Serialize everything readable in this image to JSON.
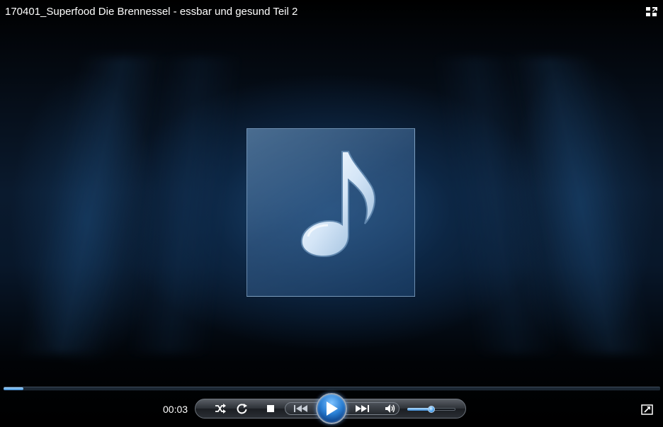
{
  "window": {
    "title": "170401_Superfood Die Brennessel - essbar und gesund Teil 2"
  },
  "artwork": {
    "icon": "music-note-icon"
  },
  "playback": {
    "elapsed": "00:03",
    "progress_fraction": 0.03,
    "state": "paused"
  },
  "volume": {
    "level_fraction": 0.5
  },
  "controls": {
    "shuffle_icon": "shuffle-icon",
    "repeat_icon": "repeat-icon",
    "stop_icon": "stop-icon",
    "previous_icon": "previous-icon",
    "play_icon": "play-icon",
    "next_icon": "next-icon",
    "mute_icon": "speaker-icon",
    "fullscreen_icon": "fullscreen-icon",
    "switch_library_icon": "switch-to-library-icon"
  },
  "colors": {
    "accent": "#2a7fd4",
    "background": "#000000",
    "text": "#ffffff"
  }
}
